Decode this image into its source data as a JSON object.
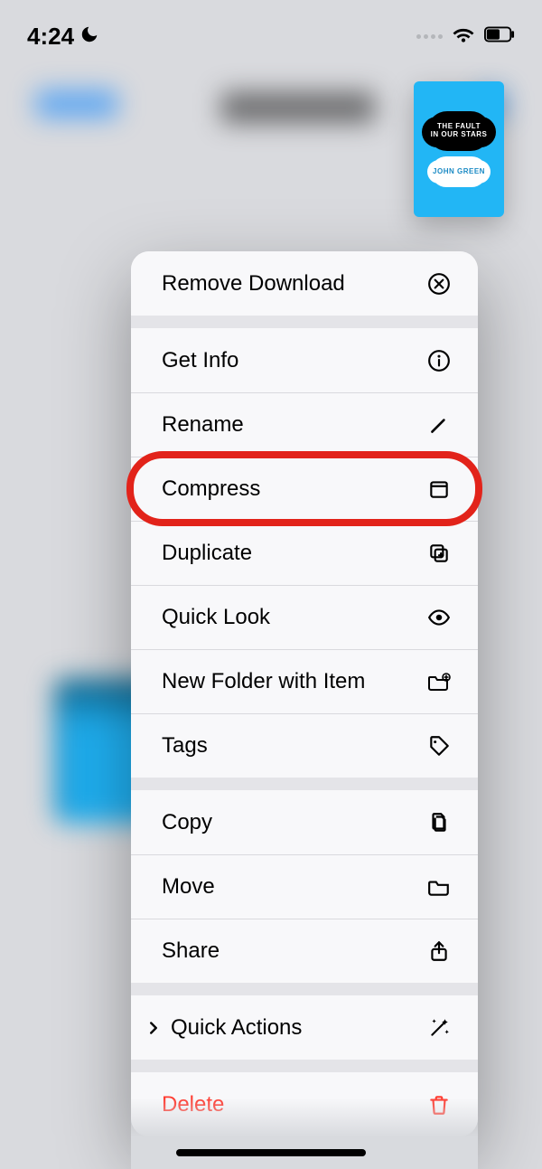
{
  "status": {
    "time": "4:24",
    "dnd": true
  },
  "file": {
    "title_line1": "THE FAULT",
    "title_line2": "IN OUR STARS",
    "author": "JOHN GREEN"
  },
  "menu": {
    "remove_download": "Remove Download",
    "get_info": "Get Info",
    "rename": "Rename",
    "compress": "Compress",
    "duplicate": "Duplicate",
    "quick_look": "Quick Look",
    "new_folder": "New Folder with Item",
    "tags": "Tags",
    "copy": "Copy",
    "move": "Move",
    "share": "Share",
    "quick_actions": "Quick Actions",
    "delete": "Delete"
  },
  "highlight": "compress",
  "colors": {
    "destructive": "#ff3b30",
    "highlight_ring": "#e2231a",
    "ios_blue": "#0a84ff",
    "book_cyan": "#22b6f5"
  }
}
